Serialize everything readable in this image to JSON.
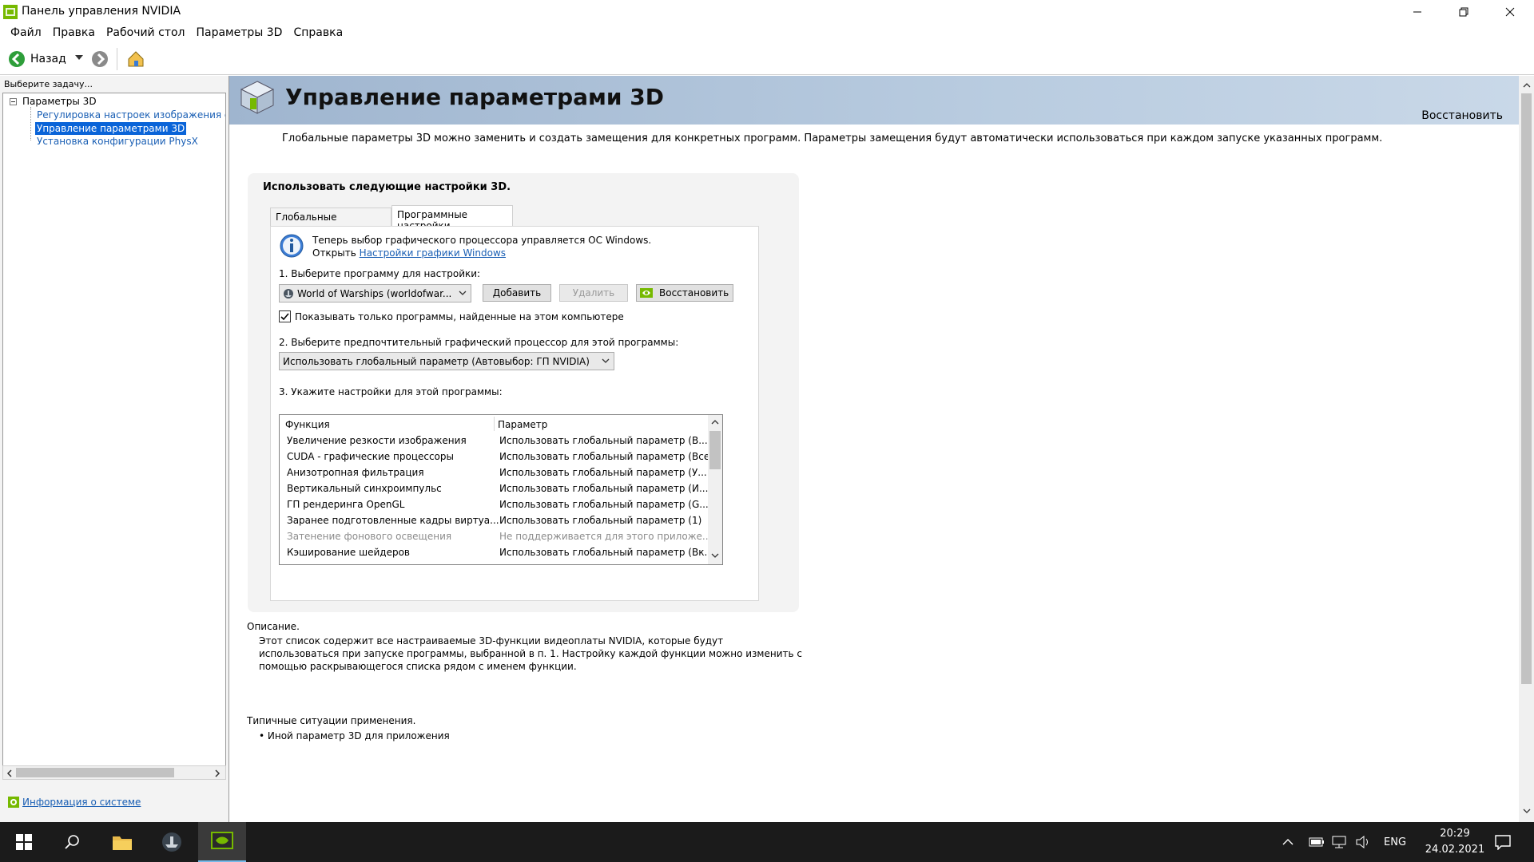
{
  "window": {
    "title": "Панель управления NVIDIA"
  },
  "menu": [
    "Файл",
    "Правка",
    "Рабочий стол",
    "Параметры 3D",
    "Справка"
  ],
  "toolbar": {
    "back_label": "Назад"
  },
  "sidebar": {
    "task_label": "Выберите задачу...",
    "tree": {
      "root": "Параметры 3D",
      "items": [
        "Регулировка настроек изображения с п",
        "Управление параметрами 3D",
        "Установка конфигурации PhysX"
      ]
    },
    "system_info_link": "Информация о системе"
  },
  "page": {
    "title": "Управление параметрами 3D",
    "restore_link": "Восстановить",
    "intro": "Глобальные параметры 3D можно заменить и создать замещения для конкретных программ. Параметры замещения будут автоматически использоваться при каждом запуске указанных программ."
  },
  "settings": {
    "header": "Использовать следующие настройки 3D.",
    "tabs": [
      "Глобальные параметры",
      "Программные настройки"
    ],
    "active_tab": 1,
    "info_line1": "Теперь выбор графического процессора управляется ОС Windows.",
    "info_open": "Открыть",
    "info_link": "Настройки графики Windows",
    "step1_label": "1. Выберите программу для настройки:",
    "program_selected": "World of Warships (worldofwar...",
    "add_button": "Добавить",
    "remove_button": "Удалить",
    "restore_button": "Восстановить",
    "checkbox_label": "Показывать только программы, найденные на этом компьютере",
    "checkbox_checked": true,
    "step2_label": "2. Выберите предпочтительный графический процессор для этой программы:",
    "gpu_selected": "Использовать глобальный параметр (Автовыбор: ГП NVIDIA)",
    "step3_label": "3. Укажите настройки для этой программы:",
    "table": {
      "col_function": "Функция",
      "col_parameter": "Параметр",
      "rows": [
        {
          "function": "Увеличение резкости изображения",
          "parameter": "Использовать глобальный параметр (В..."
        },
        {
          "function": "CUDA - графические процессоры",
          "parameter": "Использовать глобальный параметр (Все)"
        },
        {
          "function": "Анизотропная фильтрация",
          "parameter": "Использовать глобальный параметр (У..."
        },
        {
          "function": "Вертикальный синхроимпульс",
          "parameter": "Использовать глобальный параметр (И..."
        },
        {
          "function": "ГП рендеринга OpenGL",
          "parameter": "Использовать глобальный параметр (G..."
        },
        {
          "function": "Заранее подготовленные кадры виртуа...",
          "parameter": "Использовать глобальный параметр (1)"
        },
        {
          "function": "Затенение фонового освещения",
          "parameter": "Не поддерживается для этого приложе...",
          "disabled": true
        },
        {
          "function": "Кэширование шейдеров",
          "parameter": "Использовать глобальный параметр (Вк..."
        }
      ]
    }
  },
  "description": {
    "title": "Описание.",
    "body": "Этот список содержит все настраиваемые 3D-функции видеоплаты NVIDIA, которые будут использоваться при запуске программы, выбранной в п. 1. Настройку каждой функции можно изменить с помощью раскрывающегося списка рядом с именем функции."
  },
  "typical": {
    "title": "Типичные ситуации применения.",
    "item": "• Иной параметр 3D для приложения"
  },
  "taskbar": {
    "language": "ENG",
    "time": "20:29",
    "date": "24.02.2021"
  },
  "colors": {
    "nvidia_green": "#76b900",
    "selection_blue": "#0a64d8",
    "link_blue": "#1a5fb4",
    "banner": "#b9cce0",
    "taskbar": "#1b1b1b"
  }
}
